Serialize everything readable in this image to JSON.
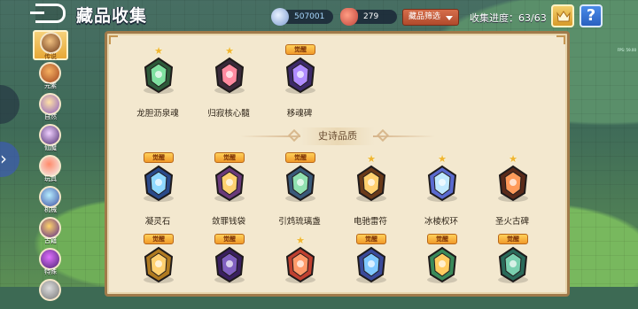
{
  "header": {
    "title": "藏品收集",
    "currency_a": "507001",
    "currency_b": "279",
    "filter_label": "藏品筛选",
    "progress": "收集进度：63/63",
    "help_label": "?",
    "fps_text": "FPS: 59.00"
  },
  "sidebar": {
    "items": [
      {
        "label": "传说",
        "icon": "legend-icon"
      },
      {
        "label": "元素",
        "icon": "element-icon"
      },
      {
        "label": "自然",
        "icon": "nature-icon"
      },
      {
        "label": "仙魔",
        "icon": "demon-icon"
      },
      {
        "label": "玩具",
        "icon": "toy-icon"
      },
      {
        "label": "机械",
        "icon": "mech-icon"
      },
      {
        "label": "古籍",
        "icon": "ancient-icon"
      },
      {
        "label": "特殊",
        "icon": "special-icon"
      },
      {
        "label": "",
        "icon": "more-icon"
      }
    ]
  },
  "collection": {
    "top_items": [
      {
        "name": "龙胆沥泉魂",
        "awake": false
      },
      {
        "name": "归寂核心髓",
        "awake": false
      },
      {
        "name": "移魂碑",
        "awake": true
      }
    ],
    "section_title": "史诗品质",
    "awake_label": "觉醒",
    "epic_items": [
      {
        "name": "凝灵石",
        "awake": true
      },
      {
        "name": "敛罪钱袋",
        "awake": true
      },
      {
        "name": "引鸩琉璃盏",
        "awake": true
      },
      {
        "name": "电驰雷符",
        "awake": false
      },
      {
        "name": "冰棱权环",
        "awake": false
      },
      {
        "name": "圣火古碑",
        "awake": false
      }
    ],
    "bottom_items": [
      {
        "name": "",
        "awake": true
      },
      {
        "name": "",
        "awake": true
      },
      {
        "name": "",
        "awake": false
      },
      {
        "name": "",
        "awake": true
      },
      {
        "name": "",
        "awake": true
      },
      {
        "name": "",
        "awake": true
      }
    ]
  },
  "colors": {
    "panel_bg": "#f3e8cf",
    "panel_border": "#a07a4a",
    "badge": "#f19a2a",
    "star": "#f0b531"
  }
}
